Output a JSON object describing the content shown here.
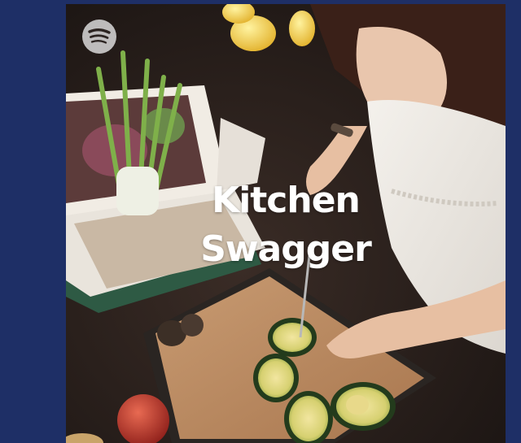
{
  "playlist": {
    "title_line1": "Kitchen",
    "title_line2": "Swagger"
  },
  "icons": {
    "brand": "spotify-logo-icon"
  },
  "colors": {
    "page_background": "#1e2f66",
    "title_text": "#ffffff",
    "logo": "#d9d9d9"
  }
}
